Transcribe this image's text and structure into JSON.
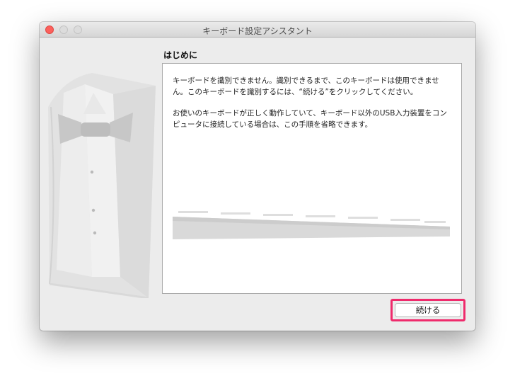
{
  "window": {
    "title": "キーボード設定アシスタント"
  },
  "section": {
    "heading": "はじめに"
  },
  "body": {
    "paragraph1": "キーボードを識別できません。識別できるまで、このキーボードは使用できません。このキーボードを識別するには、“続ける”をクリックしてください。",
    "paragraph2": "お使いのキーボードが正しく動作していて、キーボード以外のUSB入力装置をコンピュータに接続している場合は、この手順を省略できます。"
  },
  "actions": {
    "continue_label": "続ける"
  },
  "colors": {
    "highlight": "#ef2b6c",
    "close_button": "#fc605c"
  },
  "icons": {
    "illustration": "tuxedo-illustration",
    "keyboard": "keyboard-illustration"
  }
}
